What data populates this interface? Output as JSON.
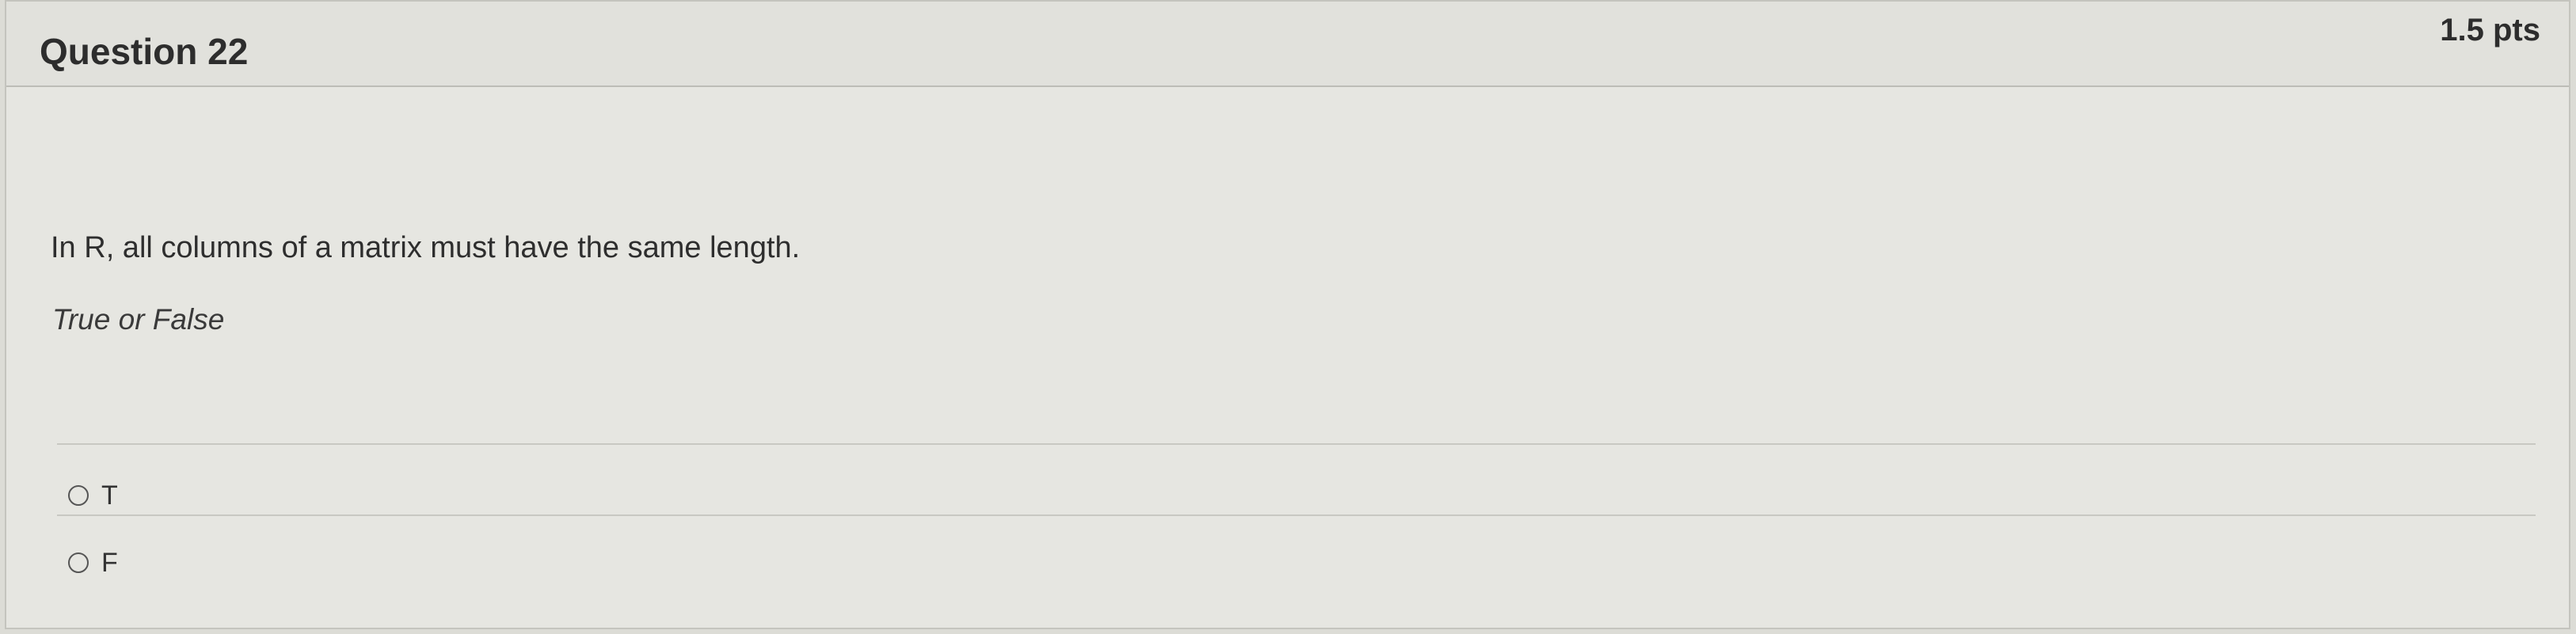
{
  "question": {
    "title": "Question 22",
    "points": "1.5 pts",
    "text": "In R, all columns of a matrix must have the same length.",
    "hint": "True or False"
  },
  "answers": [
    {
      "label": "T",
      "selected": false
    },
    {
      "label": "F",
      "selected": false
    }
  ],
  "colors": {
    "header_bg": "#e1e1dc",
    "body_bg": "#e6e6e1",
    "border": "#c4c4be",
    "text": "#2d2d2d"
  }
}
